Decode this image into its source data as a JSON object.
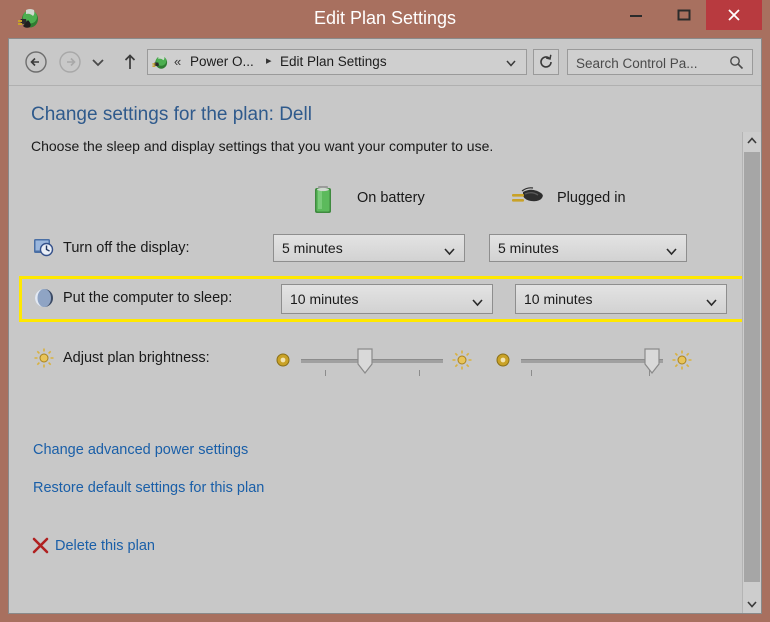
{
  "window": {
    "title": "Edit Plan Settings",
    "app_icon": "power-options-icon",
    "controls": {
      "minimize": "minimize-button",
      "maximize": "maximize-button",
      "close": "close-button"
    },
    "frame_color": "#a8705f",
    "close_color": "#b83a3f"
  },
  "navbar": {
    "back": "back-button",
    "forward": "forward-button",
    "recent": "recent-pages-button",
    "up": "up-one-level-button",
    "breadcrumb": {
      "icon": "power-options-icon",
      "leading_separator": "«",
      "items": [
        {
          "label": "Power O...",
          "separator": "▸"
        },
        {
          "label": "Edit Plan Settings",
          "separator": ""
        }
      ],
      "dropdown": "chevron-down-icon"
    },
    "refresh": "refresh-icon",
    "search": {
      "placeholder": "Search Control Pa...",
      "value": "",
      "icon": "search-icon"
    }
  },
  "content": {
    "heading": "Change settings for the plan: Dell",
    "subheading": "Choose the sleep and display settings that you want your computer to use.",
    "columns": [
      {
        "label": "On battery",
        "icon": "battery-icon"
      },
      {
        "label": "Plugged in",
        "icon": "power-plug-icon"
      }
    ],
    "rows": [
      {
        "id": "turn-off-display",
        "icon": "display-clock-icon",
        "label": "Turn off the display:",
        "type": "dropdown",
        "battery_value": "5 minutes",
        "plugged_value": "5 minutes",
        "highlighted": false
      },
      {
        "id": "put-computer-to-sleep",
        "icon": "sleep-moon-icon",
        "label": "Put the computer to sleep:",
        "type": "dropdown",
        "battery_value": "10 minutes",
        "plugged_value": "10 minutes",
        "highlighted": true,
        "highlight_color": "#ffe800"
      },
      {
        "id": "adjust-plan-brightness",
        "icon": "brightness-sun-icon",
        "label": "Adjust plan brightness:",
        "type": "slider",
        "battery_value": 45,
        "plugged_value": 92,
        "highlighted": false
      }
    ],
    "links": [
      {
        "id": "change-advanced-power-settings",
        "label": "Change advanced power settings"
      },
      {
        "id": "restore-default-settings",
        "label": "Restore default settings for this plan"
      },
      {
        "id": "delete-this-plan",
        "label": "Delete this plan",
        "icon": "red-x-icon"
      }
    ],
    "link_color": "#1a5fa8",
    "heading_color": "#2f5a8c"
  },
  "scrollbar": {
    "up": "scroll-up-arrow-icon",
    "down": "scroll-down-arrow-icon",
    "thumb": "scroll-thumb"
  }
}
